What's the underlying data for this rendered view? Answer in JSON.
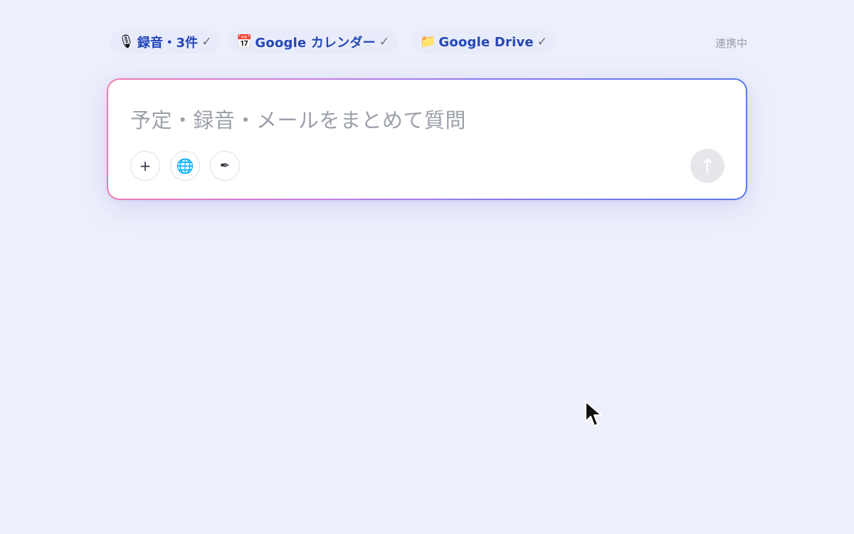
{
  "connections": {
    "items": [
      {
        "icon": "🎙",
        "label": "録音・3件",
        "check": "✓"
      },
      {
        "icon": "📅",
        "label": "Google カレンダー",
        "check": "✓"
      },
      {
        "icon": "📁",
        "label": "Google Drive",
        "check": "✓"
      }
    ],
    "status": "連携中"
  },
  "composer": {
    "placeholder": "予定・録音・メールをまとめて質問",
    "tools": {
      "add": "+",
      "web": "🌐",
      "pen": "✒"
    },
    "send": "↑"
  },
  "colors": {
    "background": "#edf0fb",
    "chip_text": "#2446b8",
    "gradient_start": "#f07ab4",
    "gradient_end": "#5a78e6"
  }
}
